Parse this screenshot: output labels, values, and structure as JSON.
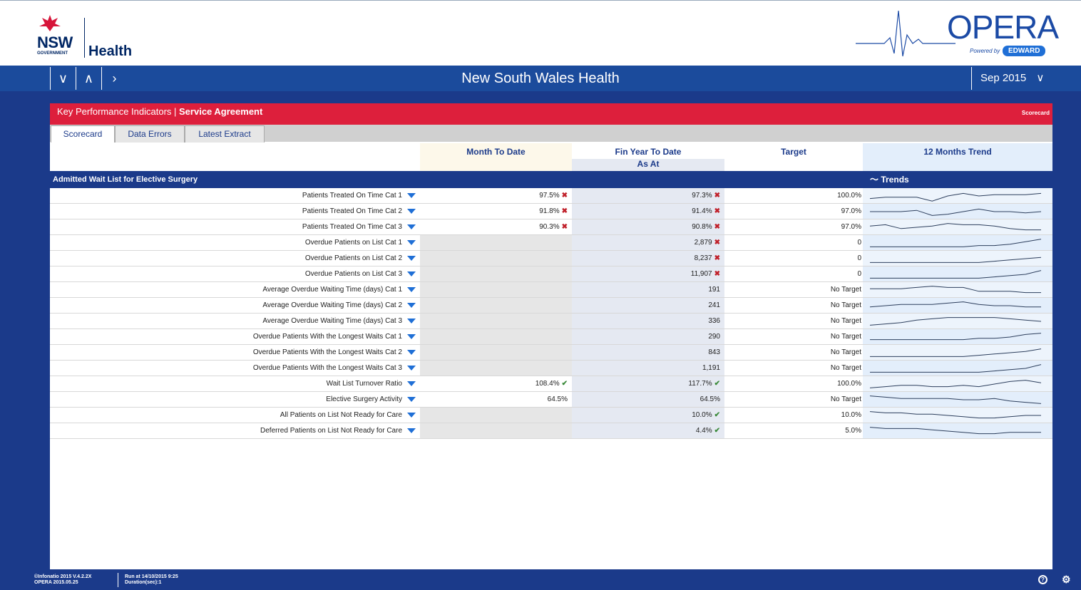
{
  "header": {
    "nsw_word": "NSW",
    "nsw_government": "GOVERNMENT",
    "health_word": "Health",
    "opera_word": "OPERA",
    "powered_by": "Powered by",
    "edward": "EDWARD"
  },
  "navbar": {
    "title": "New South Wales Health",
    "period": "Sep 2015",
    "buttons": [
      "∨",
      "∧",
      "›"
    ]
  },
  "panel": {
    "title_prefix": "Key Performance Indicators | ",
    "title_bold": "Service Agreement",
    "badge": "Scorecard"
  },
  "tabs": [
    "Scorecard",
    "Data Errors",
    "Latest Extract"
  ],
  "columns": {
    "mtd": "Month To Date",
    "ytd": "Fin Year To Date",
    "ytd_sub": "As At",
    "target": "Target",
    "trend": "12 Months Trend"
  },
  "section": {
    "title": "Admitted Wait List for Elective Surgery",
    "trends_label": "Trends"
  },
  "rows": [
    {
      "label": "Patients Treated On Time Cat 1",
      "mtd": "97.5%",
      "mtd_mark": "x",
      "ytd": "97.3%",
      "ytd_mark": "x",
      "target": "100.0%",
      "trend": [
        0.7,
        0.6,
        0.6,
        0.6,
        0.9,
        0.5,
        0.3,
        0.5,
        0.4,
        0.4,
        0.4,
        0.3
      ]
    },
    {
      "label": "Patients Treated On Time Cat 2",
      "mtd": "91.8%",
      "mtd_mark": "x",
      "ytd": "91.4%",
      "ytd_mark": "x",
      "target": "97.0%",
      "trend": [
        0.5,
        0.5,
        0.5,
        0.4,
        0.8,
        0.7,
        0.5,
        0.3,
        0.5,
        0.5,
        0.6,
        0.5
      ]
    },
    {
      "label": "Patients Treated On Time Cat 3",
      "mtd": "90.3%",
      "mtd_mark": "x",
      "ytd": "90.8%",
      "ytd_mark": "x",
      "target": "97.0%",
      "trend": [
        0.4,
        0.3,
        0.6,
        0.5,
        0.4,
        0.2,
        0.3,
        0.3,
        0.4,
        0.6,
        0.7,
        0.7
      ]
    },
    {
      "label": "Overdue Patients on List Cat 1",
      "mtd": "",
      "mtd_mark": "",
      "ytd": "2,879",
      "ytd_mark": "x",
      "target": "0",
      "trend": [
        0.8,
        0.8,
        0.8,
        0.8,
        0.8,
        0.8,
        0.8,
        0.7,
        0.7,
        0.6,
        0.4,
        0.2
      ]
    },
    {
      "label": "Overdue Patients on List Cat 2",
      "mtd": "",
      "mtd_mark": "",
      "ytd": "8,237",
      "ytd_mark": "x",
      "target": "0",
      "trend": [
        0.8,
        0.8,
        0.8,
        0.8,
        0.8,
        0.8,
        0.8,
        0.8,
        0.7,
        0.6,
        0.5,
        0.4
      ]
    },
    {
      "label": "Overdue Patients on List Cat 3",
      "mtd": "",
      "mtd_mark": "",
      "ytd": "11,907",
      "ytd_mark": "x",
      "target": "0",
      "trend": [
        0.8,
        0.8,
        0.8,
        0.8,
        0.8,
        0.8,
        0.8,
        0.8,
        0.7,
        0.6,
        0.5,
        0.2
      ]
    },
    {
      "label": "Average Overdue Waiting Time (days) Cat 1",
      "mtd": "",
      "mtd_mark": "",
      "ytd": "191",
      "ytd_mark": "",
      "target": "No Target",
      "trend": [
        0.4,
        0.4,
        0.4,
        0.3,
        0.2,
        0.3,
        0.3,
        0.6,
        0.6,
        0.6,
        0.7,
        0.7
      ]
    },
    {
      "label": "Average Overdue Waiting Time (days) Cat 2",
      "mtd": "",
      "mtd_mark": "",
      "ytd": "241",
      "ytd_mark": "",
      "target": "No Target",
      "trend": [
        0.6,
        0.5,
        0.4,
        0.4,
        0.4,
        0.3,
        0.2,
        0.4,
        0.5,
        0.5,
        0.6,
        0.6
      ]
    },
    {
      "label": "Average Overdue Waiting Time (days) Cat 3",
      "mtd": "",
      "mtd_mark": "",
      "ytd": "336",
      "ytd_mark": "",
      "target": "No Target",
      "trend": [
        0.8,
        0.7,
        0.6,
        0.4,
        0.3,
        0.2,
        0.2,
        0.2,
        0.2,
        0.3,
        0.4,
        0.5
      ]
    },
    {
      "label": "Overdue Patients With the Longest Waits Cat 1",
      "mtd": "",
      "mtd_mark": "",
      "ytd": "290",
      "ytd_mark": "",
      "target": "No Target",
      "trend": [
        0.7,
        0.7,
        0.7,
        0.7,
        0.7,
        0.7,
        0.7,
        0.6,
        0.6,
        0.5,
        0.3,
        0.2
      ]
    },
    {
      "label": "Overdue Patients With the Longest Waits Cat 2",
      "mtd": "",
      "mtd_mark": "",
      "ytd": "843",
      "ytd_mark": "",
      "target": "No Target",
      "trend": [
        0.8,
        0.8,
        0.8,
        0.8,
        0.8,
        0.8,
        0.8,
        0.7,
        0.6,
        0.5,
        0.4,
        0.2
      ]
    },
    {
      "label": "Overdue Patients With the Longest Waits Cat 3",
      "mtd": "",
      "mtd_mark": "",
      "ytd": "1,191",
      "ytd_mark": "",
      "target": "No Target",
      "trend": [
        0.8,
        0.8,
        0.8,
        0.8,
        0.8,
        0.8,
        0.8,
        0.8,
        0.7,
        0.6,
        0.5,
        0.2
      ]
    },
    {
      "label": "Wait List Turnover Ratio",
      "mtd": "108.4%",
      "mtd_mark": "ok",
      "ytd": "117.7%",
      "ytd_mark": "ok",
      "target": "100.0%",
      "trend": [
        0.8,
        0.7,
        0.6,
        0.6,
        0.7,
        0.7,
        0.6,
        0.7,
        0.5,
        0.3,
        0.2,
        0.4
      ]
    },
    {
      "label": "Elective Surgery Activity",
      "mtd": "64.5%",
      "mtd_mark": "",
      "ytd": "64.5%",
      "ytd_mark": "",
      "target": "No Target",
      "trend": [
        0.2,
        0.3,
        0.4,
        0.4,
        0.4,
        0.4,
        0.5,
        0.5,
        0.4,
        0.6,
        0.7,
        0.8
      ]
    },
    {
      "label": "All Patients on List Not Ready for Care",
      "mtd": "",
      "mtd_mark": "",
      "ytd": "10.0%",
      "ytd_mark": "ok",
      "target": "10.0%",
      "trend": [
        0.2,
        0.3,
        0.3,
        0.4,
        0.4,
        0.5,
        0.6,
        0.7,
        0.7,
        0.6,
        0.5,
        0.5
      ]
    },
    {
      "label": "Deferred Patients on List Not Ready for Care",
      "mtd": "",
      "mtd_mark": "",
      "ytd": "4.4%",
      "ytd_mark": "ok",
      "target": "5.0%",
      "trend": [
        0.2,
        0.3,
        0.3,
        0.3,
        0.4,
        0.5,
        0.6,
        0.7,
        0.7,
        0.6,
        0.6,
        0.6
      ]
    }
  ],
  "footer": {
    "line1a": "©Infonatio 2015 V.4.2.2X",
    "line1b": "OPERA 2015.05.25",
    "line2a": "Run at 14/10/2015 9:25",
    "line2b": "Duration(sec):1",
    "help": "?"
  },
  "colors": {
    "navy": "#1b3a8a",
    "accent_red": "#dd1f3c",
    "fail": "#c0202a",
    "pass": "#3a8a3a",
    "trend_bg": "#e3eefb"
  }
}
